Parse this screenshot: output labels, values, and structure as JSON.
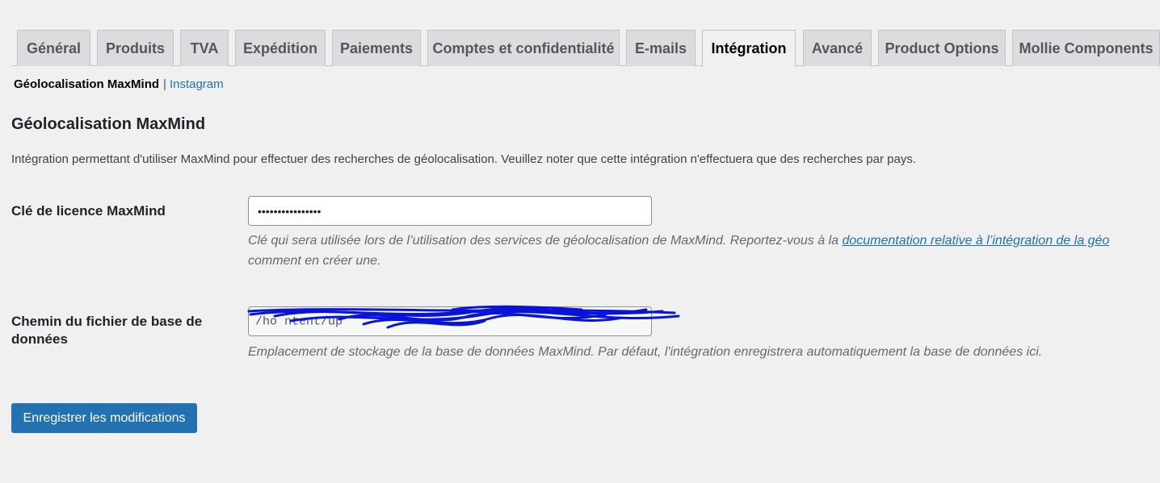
{
  "tabs": [
    {
      "label": "Général",
      "active": false
    },
    {
      "label": "Produits",
      "active": false
    },
    {
      "label": "TVA",
      "active": false
    },
    {
      "label": "Expédition",
      "active": false
    },
    {
      "label": "Paiements",
      "active": false
    },
    {
      "label": "Comptes et confidentialité",
      "active": false
    },
    {
      "label": "E-mails",
      "active": false
    },
    {
      "label": "Intégration",
      "active": true
    },
    {
      "label": "Avancé",
      "active": false
    },
    {
      "label": "Product Options",
      "active": false
    },
    {
      "label": "Mollie Components",
      "active": false
    }
  ],
  "subnav": {
    "current": "Géolocalisation MaxMind",
    "separator": "|",
    "link": "Instagram"
  },
  "section": {
    "title": "Géolocalisation MaxMind",
    "intro": "Intégration permettant d'utiliser MaxMind pour effectuer des recherches de géolocalisation. Veuillez noter que cette intégration n'effectuera que des recherches par pays."
  },
  "license": {
    "label": "Clé de licence MaxMind",
    "value_masked": "••••••••••••••••",
    "desc_text": "Clé qui sera utilisée lors de l’utilisation des services de géolocalisation de MaxMind. Reportez-vous à la ",
    "desc_link": "documentation relative à l’intégration de la géo",
    "desc_line2": "comment en créer une."
  },
  "db_path": {
    "label": "Chemin du fichier de base de données",
    "value": "/ho                                              ntent/up",
    "desc": "Emplacement de stockage de la base de données MaxMind. Par défaut, l'intégration enregistrera automatiquement la base de données ici.",
    "redaction_color": "#0a14d8"
  },
  "actions": {
    "save_label": "Enregistrer les modifications"
  },
  "colors": {
    "background": "#f0f0f1",
    "link": "#2271b1",
    "button": "#2271b1"
  }
}
